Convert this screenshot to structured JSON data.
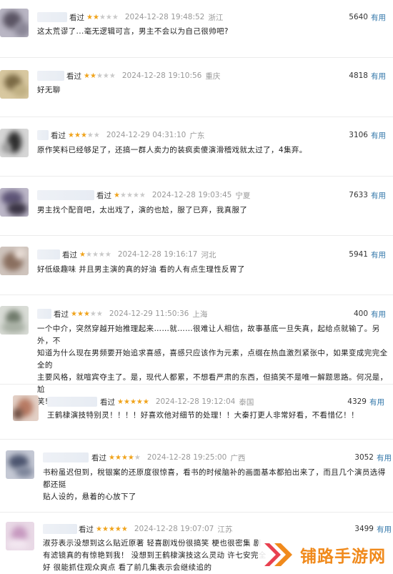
{
  "comments": [
    {
      "watched": "看过",
      "stars": 2,
      "time": "2024-12-28 19:48:52",
      "location": "浙江",
      "votes": "5640",
      "useful": "有用",
      "lines": [
        "这太荒谬了...毫无逻辑可言，男主不会以为自己很帅吧?"
      ]
    },
    {
      "watched": "看过",
      "stars": 2,
      "time": "2024-12-28 19:10:56",
      "location": "重庆",
      "votes": "4818",
      "useful": "有用",
      "lines": [
        "好无聊"
      ]
    },
    {
      "watched": "看过",
      "stars": 3,
      "time": "2024-12-29 04:31:10",
      "location": "广东",
      "votes": "3106",
      "useful": "有用",
      "lines": [
        "原作笑料已经够足了，还搞一群人卖力的装疯卖傻演滑稽戏就太过了，4集弃。"
      ]
    },
    {
      "watched": "看过",
      "stars": 1,
      "time": "2024-12-28 19:03:45",
      "location": "宁夏",
      "votes": "7633",
      "useful": "有用",
      "lines": [
        "男主找个配音吧，太出戏了，演的也尬，服了已弃，我真服了"
      ]
    },
    {
      "watched": "看过",
      "stars": 1,
      "time": "2024-12-28 19:16:17",
      "location": "河北",
      "votes": "5941",
      "useful": "有用",
      "lines": [
        "好低级趣味 并且男主演的真的好油 看的人有点生理性反胃了"
      ]
    },
    {
      "watched": "看过",
      "stars": 3,
      "time": "2024-12-29 11:50:36",
      "location": "上海",
      "votes": "400",
      "useful": "有用",
      "lines": [
        "一个中介，突然穿越开始推理起来……就……很难让人相信，故事基底一旦失真，起给点就输了。另外，不",
        "知道为什么现在男频要开始追求喜感，喜感只应该作为元素，点缀在热血激烈紧张中，如果变成完完全全的",
        "主要风格，就喧宾夺主了。是，现代人都累，不想看严肃的东西，但搞笑不是唯一解题思路。何况是，尬",
        "笑!"
      ]
    },
    {
      "watched": "看过",
      "stars": 5,
      "time": "2024-12-28 19:12:04",
      "location": "泰国",
      "votes": "4329",
      "useful": "有用",
      "lines": [
        "王鹤棣演技特别灵！！！！好喜欢他对细节的处理！！大秦打更人非常好看，不看惜亿！！"
      ]
    },
    {
      "watched": "看过",
      "stars": 4,
      "time": "2024-12-28 19:25:00",
      "location": "广西",
      "votes": "3052",
      "useful": "有用",
      "lines": [
        "书粉虽迟但到，稅银案的还原度很惊喜，看书的时候脑补的画面基本都拍出来了，而且几个演员选得都还挺",
        "贴人设的，悬着的心放下了"
      ]
    },
    {
      "watched": "看过",
      "stars": 5,
      "time": "2024-12-28 19:07:07",
      "location": "江苏",
      "votes": "3499",
      "useful": "有用",
      "lines": [
        "淑芬表示没想到这么贴近原著 轻喜剧戏份很搞笑 梗也很密集 剧",
        "有滤镜真的有惊艳到我！ 没想到王鹤棣演技这么灵动 许七安完全",
        "好 很能抓住观众爽点 看了前几集表示会继续追的"
      ]
    }
  ],
  "watermark": {
    "text": "铺路手游网",
    "icon": "double-chevron-logo-icon",
    "color": "#f08a1c"
  }
}
